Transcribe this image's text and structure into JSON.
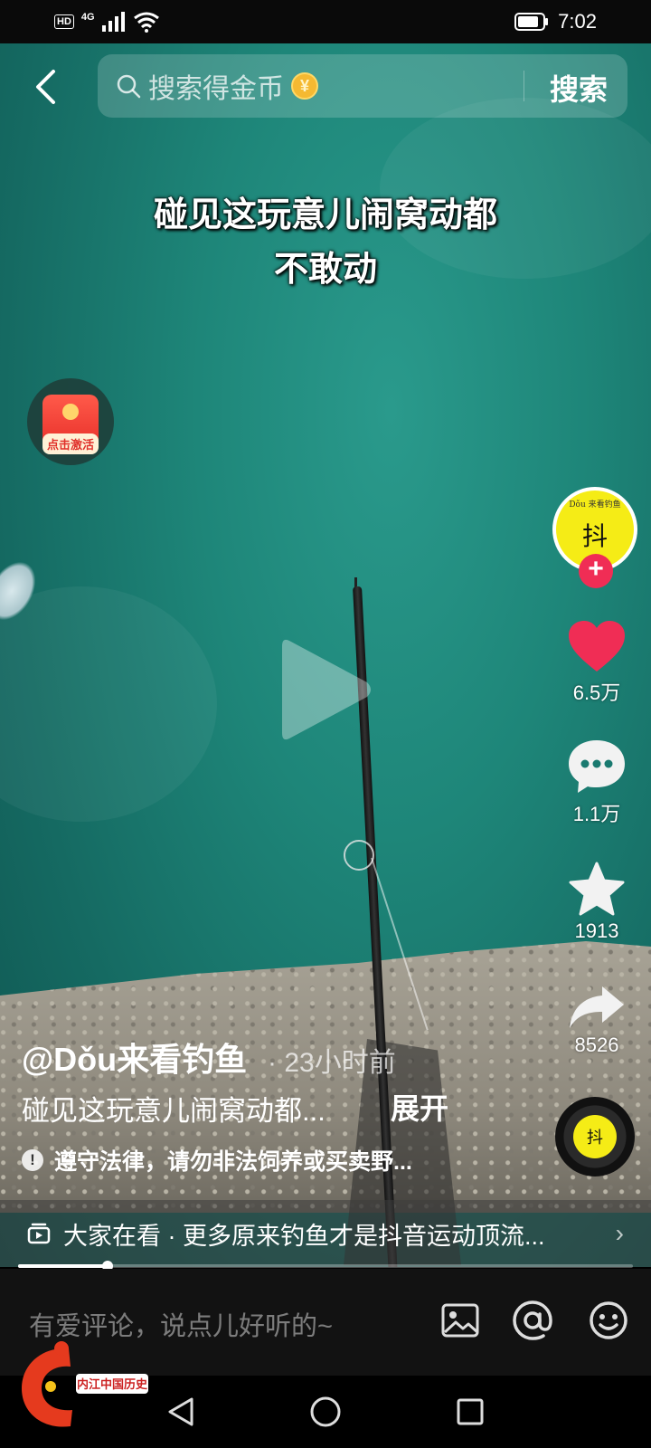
{
  "status_bar": {
    "hd": "HD",
    "network": "4G",
    "time": "7:02"
  },
  "search": {
    "placeholder": "搜索得金币",
    "coin_symbol": "¥",
    "button_label": "搜索"
  },
  "video": {
    "caption_line1": "碰见这玩意儿闹窝动都",
    "caption_line2": "不敢动"
  },
  "red_packet": {
    "label": "点击激活"
  },
  "creator": {
    "avatar_text": "抖",
    "avatar_ring": "Dǒu 来看钓鱼",
    "follow_symbol": "+"
  },
  "actions": {
    "likes": "6.5万",
    "comments": "1.1万",
    "favorites": "1913",
    "shares": "8526"
  },
  "post": {
    "author": "@Dǒu来看钓鱼",
    "time_ago": "· 23小时前",
    "description": "碰见这玩意儿闹窝动都...",
    "expand_label": "展开",
    "notice": "遵守法律，请勿非法饲养或买卖野...",
    "notice_icon": "!"
  },
  "music": {
    "disc_text": "抖"
  },
  "related": {
    "text": "大家在看 · 更多原来钓鱼才是抖音运动顶流...",
    "chevron": "›"
  },
  "progress": {
    "fraction": 0.145
  },
  "comment": {
    "placeholder": "有爱评论，说点儿好听的~"
  },
  "watermark": {
    "text": "内江中国历史"
  },
  "colors": {
    "like": "#f02d55",
    "follow": "#f02d55",
    "avatar_bg": "#f5ec16",
    "water": "#1e8679"
  }
}
